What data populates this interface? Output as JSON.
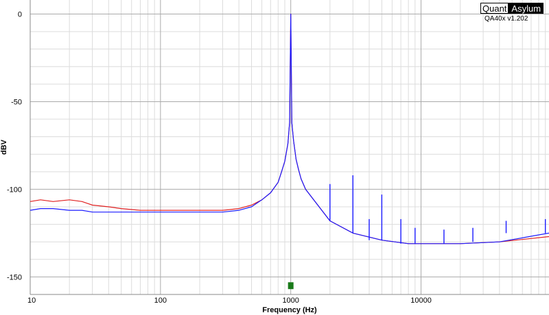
{
  "brand": {
    "part1": "Quant",
    "part2": "Asylum",
    "version": "QA40x v1.202"
  },
  "chart_data": {
    "type": "line",
    "xlabel": "Frequency (Hz)",
    "ylabel": "dBV",
    "xscale": "log",
    "xlim": [
      10,
      96000
    ],
    "ylim": [
      -160,
      8
    ],
    "xticks": [
      10,
      100,
      1000,
      10000
    ],
    "xtick_labels": [
      "10",
      "100",
      "1000",
      "10000"
    ],
    "yticks": [
      0,
      -50,
      -100,
      -150
    ],
    "ytick_labels": [
      "0",
      "-50",
      "-100",
      "-150"
    ],
    "grid": true,
    "colors": {
      "left": "#e02020",
      "right": "#1a1aff",
      "marker": "#1a7a1a"
    },
    "marker": {
      "x": 1000,
      "y": -155
    },
    "series": [
      {
        "x": [
          10,
          12,
          15,
          20,
          25,
          30,
          40,
          50,
          70,
          100,
          150,
          200,
          300,
          400,
          500,
          600,
          700,
          800,
          850,
          900,
          950,
          980,
          1000,
          1020,
          1050,
          1100,
          1150,
          1200,
          1300,
          1500,
          2000,
          3000,
          5000,
          8000,
          10000,
          20000,
          40000,
          96000
        ],
        "y": [
          -107,
          -106,
          -107,
          -106,
          -107,
          -109,
          -110,
          -111,
          -112,
          -112,
          -112,
          -112,
          -112,
          -111,
          -109,
          -106,
          -102,
          -96,
          -90,
          -84,
          -74,
          -62,
          0,
          -62,
          -72,
          -83,
          -89,
          -94,
          -100,
          -106,
          -118,
          -125,
          -129,
          -131,
          -131,
          -131,
          -130,
          -127
        ]
      },
      {
        "x": [
          10,
          12,
          15,
          20,
          25,
          30,
          40,
          50,
          70,
          100,
          150,
          200,
          300,
          400,
          500,
          600,
          700,
          800,
          850,
          900,
          950,
          980,
          1000,
          1020,
          1050,
          1100,
          1150,
          1200,
          1300,
          1500,
          2000,
          3000,
          5000,
          8000,
          10000,
          20000,
          40000,
          96000
        ],
        "y": [
          -112,
          -111,
          -111,
          -112,
          -112,
          -113,
          -113,
          -113,
          -113,
          -113,
          -113,
          -113,
          -113,
          -112,
          -110,
          -106,
          -102,
          -96,
          -90,
          -84,
          -74,
          -62,
          0,
          -62,
          -72,
          -83,
          -89,
          -94,
          -100,
          -106,
          -118,
          -125,
          -129,
          -131,
          -131,
          -131,
          -130,
          -125
        ]
      }
    ],
    "harmonics": [
      {
        "x": 2000,
        "y": -97
      },
      {
        "x": 3000,
        "y": -92
      },
      {
        "x": 4000,
        "y": -117
      },
      {
        "x": 5000,
        "y": -103
      },
      {
        "x": 7000,
        "y": -117
      },
      {
        "x": 9000,
        "y": -122
      },
      {
        "x": 15000,
        "y": -123
      },
      {
        "x": 25000,
        "y": -122
      },
      {
        "x": 45000,
        "y": -118
      },
      {
        "x": 90000,
        "y": -117
      }
    ]
  }
}
